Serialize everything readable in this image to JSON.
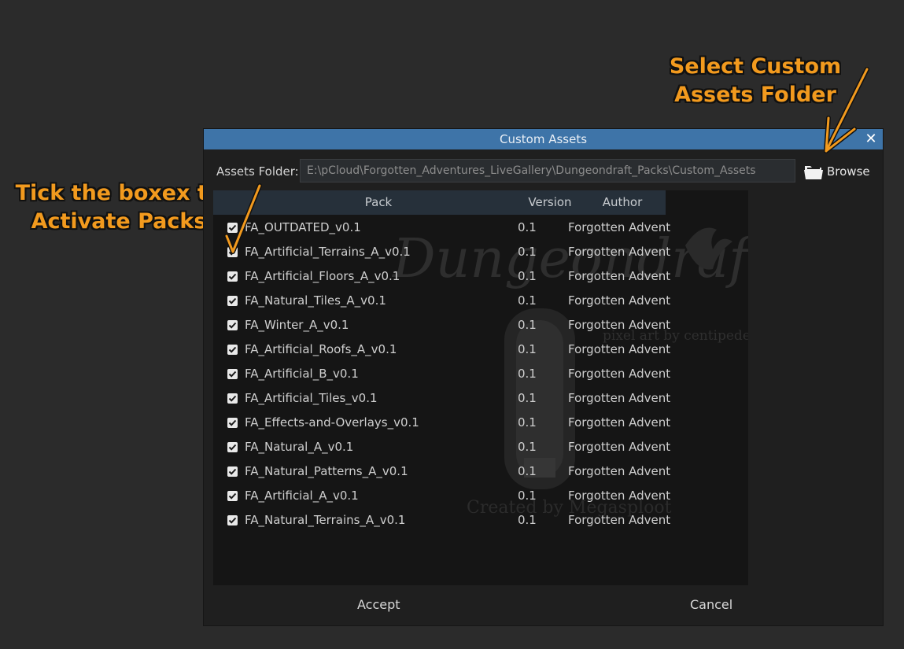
{
  "annotations": {
    "left": [
      "Tick the boxex to",
      "Activate Packs"
    ],
    "right": [
      "Select Custom",
      "Assets Folder"
    ]
  },
  "dialog": {
    "title": "Custom Assets",
    "close_glyph": "✕",
    "folder": {
      "label": "Assets Folder:",
      "value": "E:\\pCloud\\Forgotten_Adventures_LiveGallery\\Dungeondraft_Packs\\Custom_Assets"
    },
    "browse_label": "Browse",
    "columns": {
      "pack": "Pack",
      "version": "Version",
      "author": "Author"
    },
    "rows": [
      {
        "pack": "FA_OUTDATED_v0.1",
        "version": "0.1",
        "author": "Forgotten Advent",
        "checked": true
      },
      {
        "pack": "FA_Artificial_Terrains_A_v0.1",
        "version": "0.1",
        "author": "Forgotten Advent",
        "checked": true
      },
      {
        "pack": "FA_Artificial_Floors_A_v0.1",
        "version": "0.1",
        "author": "Forgotten Advent",
        "checked": true
      },
      {
        "pack": "FA_Natural_Tiles_A_v0.1",
        "version": "0.1",
        "author": "Forgotten Advent",
        "checked": true
      },
      {
        "pack": "FA_Winter_A_v0.1",
        "version": "0.1",
        "author": "Forgotten Advent",
        "checked": true
      },
      {
        "pack": "FA_Artificial_Roofs_A_v0.1",
        "version": "0.1",
        "author": "Forgotten Advent",
        "checked": true
      },
      {
        "pack": "FA_Artificial_B_v0.1",
        "version": "0.1",
        "author": "Forgotten Advent",
        "checked": true
      },
      {
        "pack": "FA_Artificial_Tiles_v0.1",
        "version": "0.1",
        "author": "Forgotten Advent",
        "checked": true
      },
      {
        "pack": "FA_Effects-and-Overlays_v0.1",
        "version": "0.1",
        "author": "Forgotten Advent",
        "checked": true
      },
      {
        "pack": "FA_Natural_A_v0.1",
        "version": "0.1",
        "author": "Forgotten Advent",
        "checked": true
      },
      {
        "pack": "FA_Natural_Patterns_A_v0.1",
        "version": "0.1",
        "author": "Forgotten Advent",
        "checked": true
      },
      {
        "pack": "FA_Artificial_A_v0.1",
        "version": "0.1",
        "author": "Forgotten Advent",
        "checked": true
      },
      {
        "pack": "FA_Natural_Terrains_A_v0.1",
        "version": "0.1",
        "author": "Forgotten Advent",
        "checked": true
      }
    ],
    "watermark": {
      "logo": "Dungeondraft",
      "credit_line": "pixel art by centipede",
      "created_by": "Created by Megasploot"
    },
    "accept_label": "Accept",
    "cancel_label": "Cancel"
  },
  "colors": {
    "title_bar": "#3e74a8",
    "annotation": "#f29a1e",
    "background": "#2b2b2b"
  },
  "icons": {
    "close": "close-icon",
    "folder": "folder-open-icon",
    "checkbox": "checkmark-icon"
  }
}
